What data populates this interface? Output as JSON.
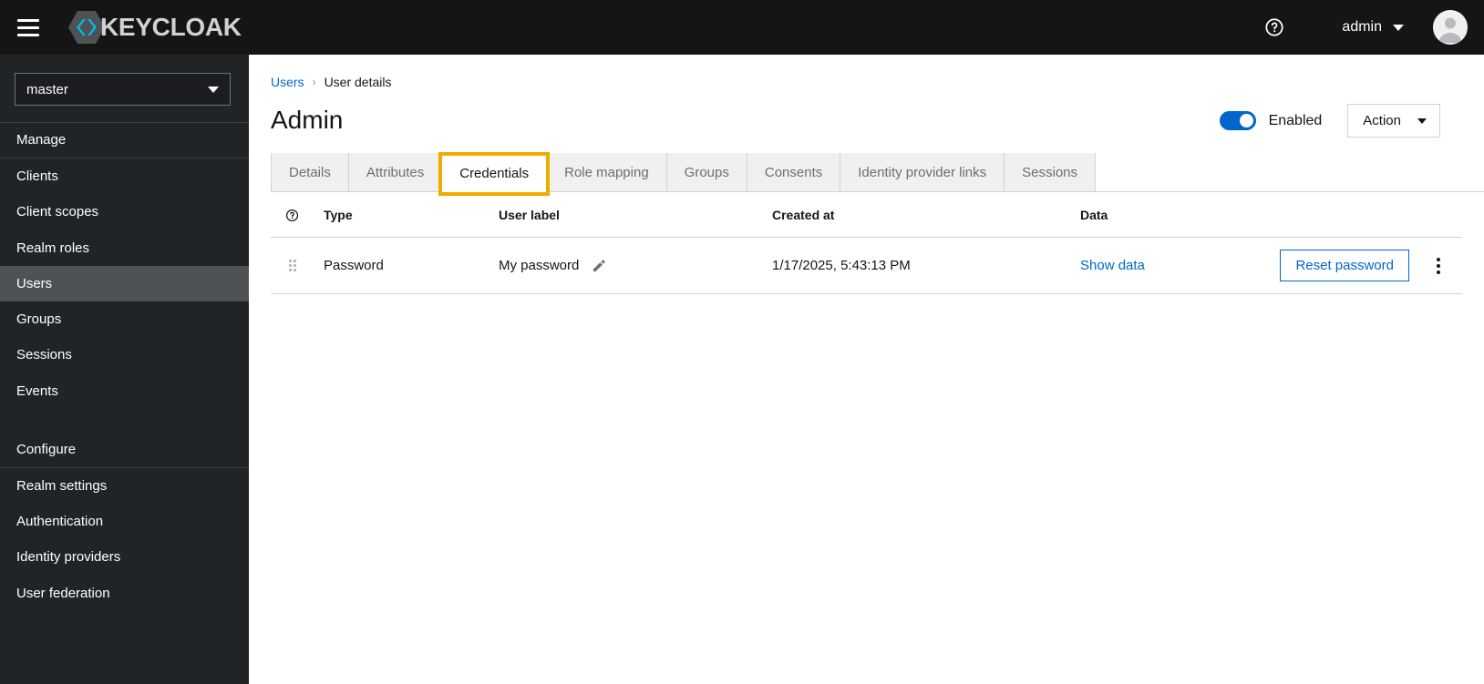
{
  "masthead": {
    "menu_icon": "hamburger-icon",
    "brand_name": "KEYCLOAK",
    "help_icon": "help-circle-icon",
    "user_name": "admin",
    "user_caret_icon": "chevron-down-icon",
    "avatar_icon": "user-avatar-icon"
  },
  "sidebar": {
    "realm": {
      "selected": "master",
      "caret_icon": "chevron-down-icon"
    },
    "sections": [
      {
        "title": "Manage",
        "items": [
          {
            "label": "Clients",
            "active": false
          },
          {
            "label": "Client scopes",
            "active": false
          },
          {
            "label": "Realm roles",
            "active": false
          },
          {
            "label": "Users",
            "active": true
          },
          {
            "label": "Groups",
            "active": false
          },
          {
            "label": "Sessions",
            "active": false
          },
          {
            "label": "Events",
            "active": false
          }
        ]
      },
      {
        "title": "Configure",
        "items": [
          {
            "label": "Realm settings",
            "active": false
          },
          {
            "label": "Authentication",
            "active": false
          },
          {
            "label": "Identity providers",
            "active": false
          },
          {
            "label": "User federation",
            "active": false
          }
        ]
      }
    ]
  },
  "page": {
    "breadcrumb": {
      "parent": "Users",
      "separator": "›",
      "current": "User details"
    },
    "title": "Admin",
    "enabled_toggle": {
      "label": "Enabled",
      "state": "on"
    },
    "action_button": {
      "label": "Action",
      "caret_icon": "chevron-down-icon"
    }
  },
  "tabs": [
    {
      "label": "Details",
      "active": false,
      "highlighted": false
    },
    {
      "label": "Attributes",
      "active": false,
      "highlighted": false
    },
    {
      "label": "Credentials",
      "active": true,
      "highlighted": true
    },
    {
      "label": "Role mapping",
      "active": false,
      "highlighted": false
    },
    {
      "label": "Groups",
      "active": false,
      "highlighted": false
    },
    {
      "label": "Consents",
      "active": false,
      "highlighted": false
    },
    {
      "label": "Identity provider links",
      "active": false,
      "highlighted": false
    },
    {
      "label": "Sessions",
      "active": false,
      "highlighted": false
    }
  ],
  "credentials_table": {
    "headers": {
      "help_icon": "help-circle-icon",
      "type": "Type",
      "user_label": "User label",
      "created_at": "Created at",
      "data": "Data"
    },
    "rows": [
      {
        "drag_handle_icon": "drag-grip-icon",
        "type": "Password",
        "user_label": "My password",
        "edit_icon": "pencil-edit-icon",
        "created_at": "1/17/2025, 5:43:13 PM",
        "show_data_link": "Show data",
        "reset_button": "Reset password",
        "kebab_icon": "kebab-menu-icon"
      }
    ]
  },
  "colors": {
    "masthead_bg": "#151515",
    "sidebar_bg": "#212427",
    "sidebar_active": "#4f5255",
    "accent_blue": "#0066cc",
    "highlight_orange": "#f0ab00",
    "tab_inactive_bg": "#f0f0f0",
    "border_gray": "#d2d2d2"
  }
}
